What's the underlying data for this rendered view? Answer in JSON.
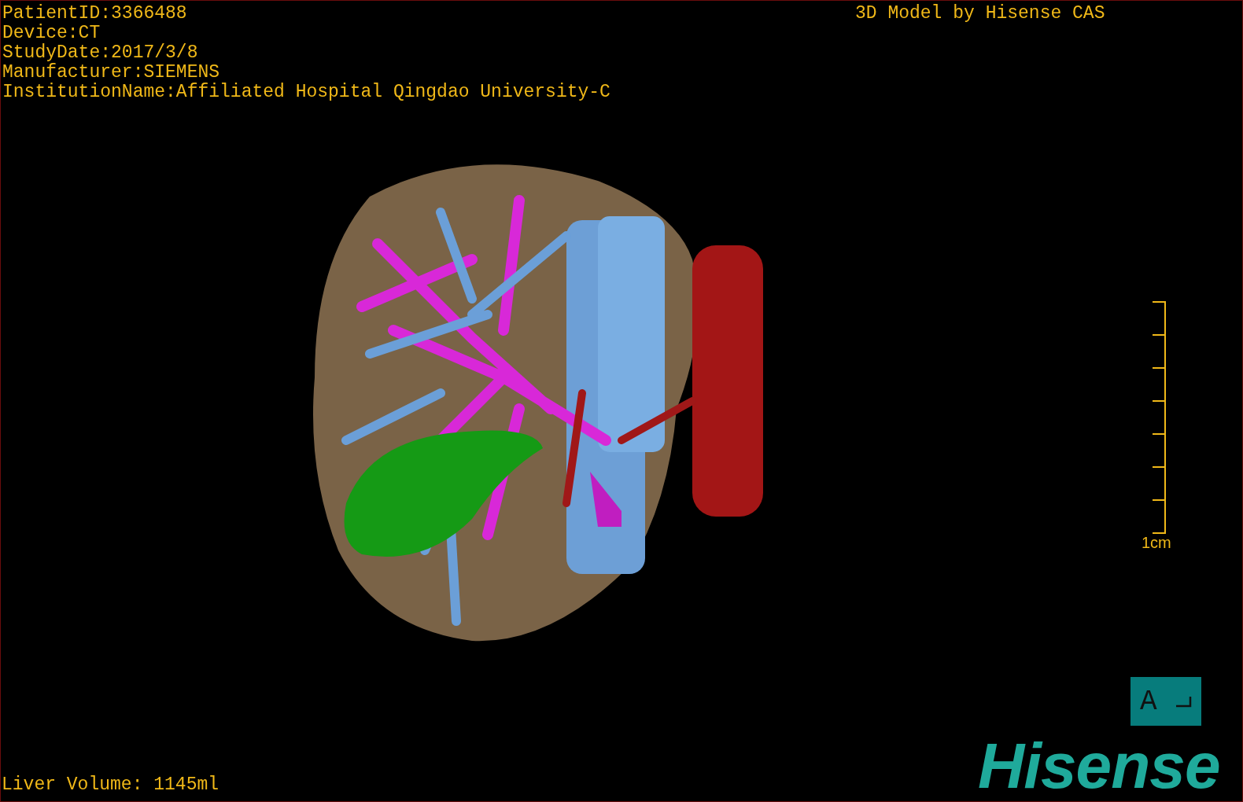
{
  "patient_info": [
    "PatientID:3366488",
    "Device:CT",
    "StudyDate:2017/3/8",
    "Manufacturer:SIEMENS",
    "InstitutionName:Affiliated Hospital Qingdao University-C"
  ],
  "model_caption": "3D Model by Hisense CAS",
  "scale_bar": {
    "label": "1cm"
  },
  "orientation_button": {
    "label": "A"
  },
  "liver_volume": "Liver Volume: 1145ml",
  "logo": "Hisense"
}
